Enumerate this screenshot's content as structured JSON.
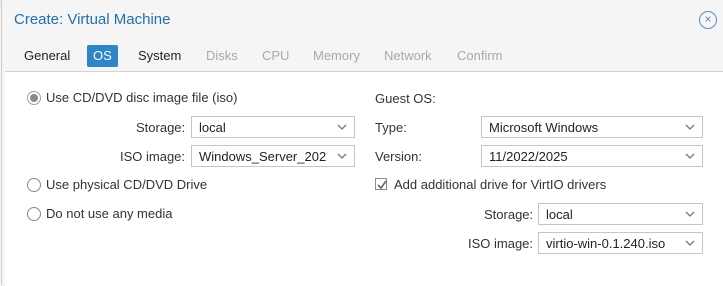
{
  "dialog": {
    "title": "Create: Virtual Machine",
    "close_icon": "close-icon"
  },
  "tabs": [
    {
      "label": "General",
      "state": "enabled"
    },
    {
      "label": "OS",
      "state": "active"
    },
    {
      "label": "System",
      "state": "enabled"
    },
    {
      "label": "Disks",
      "state": "disabled"
    },
    {
      "label": "CPU",
      "state": "disabled"
    },
    {
      "label": "Memory",
      "state": "disabled"
    },
    {
      "label": "Network",
      "state": "disabled"
    },
    {
      "label": "Confirm",
      "state": "disabled"
    }
  ],
  "media": {
    "iso_option": {
      "label": "Use CD/DVD disc image file (iso)",
      "checked": true
    },
    "storage": {
      "label": "Storage:",
      "value": "local"
    },
    "iso_image": {
      "label": "ISO image:",
      "value": "Windows_Server_202"
    },
    "physical_option": {
      "label": "Use physical CD/DVD Drive",
      "checked": false
    },
    "none_option": {
      "label": "Do not use any media",
      "checked": false
    }
  },
  "guest_os": {
    "heading": "Guest OS:",
    "type": {
      "label": "Type:",
      "value": "Microsoft Windows"
    },
    "version": {
      "label": "Version:",
      "value": "11/2022/2025"
    },
    "virtio_checkbox": {
      "label": "Add additional drive for VirtIO drivers",
      "checked": true
    },
    "virtio_storage": {
      "label": "Storage:",
      "value": "local"
    },
    "virtio_iso": {
      "label": "ISO image:",
      "value": "virtio-win-0.1.240.iso"
    }
  },
  "colors": {
    "accent": "#2e86c8",
    "title": "#1f6fb3",
    "disabled_text": "#a9a9a9"
  }
}
